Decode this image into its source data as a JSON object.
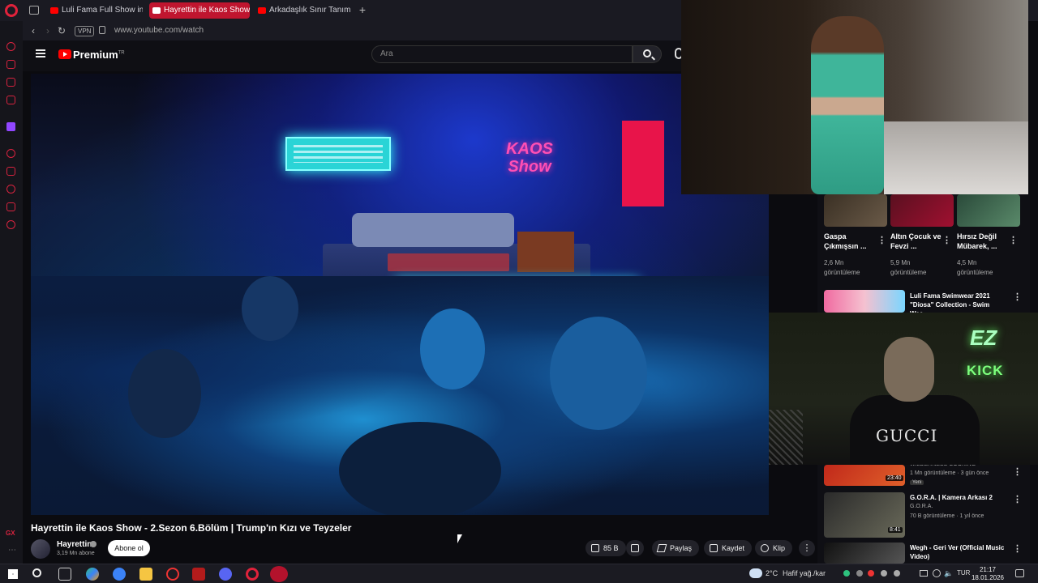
{
  "browser": {
    "tabs": [
      {
        "label": "Luli Fama Full Show in SLO"
      },
      {
        "label": "Hayrettin ile Kaos Show"
      },
      {
        "label": "Arkadaşlık Sınır Tanımaz M"
      }
    ],
    "vpn_label": "VPN",
    "url": "www.youtube.com/watch"
  },
  "youtube": {
    "logo_text": "Premium",
    "logo_region": "TR",
    "search_placeholder": "Ara"
  },
  "video": {
    "title": "Hayrettin ile Kaos Show - 2.Sezon 6.Bölüm | Trump'ın Kızı ve Teyzeler",
    "channel": "Hayrettin",
    "subscribers": "3,19 Mn abone",
    "subscribe_label": "Abone ol",
    "likes": "85 B",
    "share_label": "Paylaş",
    "save_label": "Kaydet",
    "clip_label": "Klip",
    "more_label": "⋮",
    "scene_sign": "KAOS Show"
  },
  "shorts": [
    {
      "title": "Gaspa Çıkmışsın ...",
      "views": "2,6 Mn görüntüleme"
    },
    {
      "title": "Altın Çocuk ve Fevzi ...",
      "views": "5,9 Mn görüntüleme"
    },
    {
      "title": "Hırsız Değil Mübarek, ...",
      "views": "4,5 Mn görüntüleme"
    }
  ],
  "recommended": [
    {
      "title": "Luli Fama Swimwear 2021 \"Diosa\" Collection - Swim Wee..."
    },
    {
      "channel": "WILDERNESS COOKING",
      "meta": "1 Mn görüntüleme · 3 gün önce",
      "badge": "Yeni",
      "duration": "23:40"
    },
    {
      "title": "G.O.R.A. | Kamera Arkası 2",
      "channel": "G.O.R.A.",
      "meta": "70 B görüntüleme · 1 yıl önce",
      "duration": "8:41"
    },
    {
      "title": "Wegh - Geri Ver (Official Music Video)"
    }
  ],
  "overlays": {
    "runway_caption": "",
    "webcam_shirt": "GUCCI",
    "webcam_sign_1": "EZ",
    "webcam_sign_2": "KICK"
  },
  "taskbar": {
    "weather_temp": "2°C",
    "weather_desc": "Hafif yağ./kar",
    "lang": "TUR",
    "time": "21:17",
    "date": "18.01.2026"
  },
  "colors": {
    "opera_red": "#d8233f",
    "active_tab": "#c0152f",
    "youtube_red": "#ff0000"
  }
}
